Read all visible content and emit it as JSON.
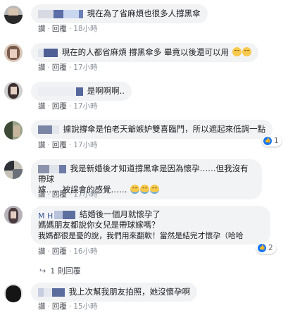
{
  "comments": [
    {
      "text": "現在為了省麻煩也很多人撐黑傘",
      "reply": "回覆",
      "time": "18小時"
    },
    {
      "text": "現在的人都省麻煩 撐黑傘多 畢竟以後還可以用",
      "reply": "回覆",
      "time": "17小時",
      "emoji": [
        "laugh-emoji",
        "laugh-emoji"
      ]
    },
    {
      "text": "是啊啊啊..",
      "reply": "回覆",
      "time": "17小時"
    },
    {
      "text": "據說撐傘是怕老天爺嫉妒雙喜臨門，所以遮起來低調一點",
      "reply": "回覆",
      "time": "17小時",
      "reactions": "1"
    },
    {
      "text_line1": "我是新婚後才知道撐黑傘是因為懷孕……但我沒有帶球",
      "text_line2": "嫁……被誤會的感覺……",
      "reply": "回覆",
      "time": "17小時",
      "emoji": [
        "cry-emoji",
        "cry-emoji",
        "cry-emoji"
      ]
    },
    {
      "name": "M  H",
      "text_line1": "結婚後一個月就懷孕了",
      "text_line2": "媽媽朋友都說你女兒是帶球嫁嗎？",
      "text_line3": "我媽都很是憂的說，我們用來翻軟！當然是結完才懷孕（哈哈",
      "reply": "回覆",
      "time": "16小時",
      "reactions": "2"
    },
    {
      "text": "我上次幫我朋友拍照，她沒懷孕啊",
      "reply": "回覆",
      "time": "15小時"
    }
  ],
  "replies_link": "1 則回覆",
  "like_label": "讚",
  "colors": {
    "bubble": "#f2f3f5",
    "meta": "#8d949e",
    "like": "#1877f2"
  }
}
